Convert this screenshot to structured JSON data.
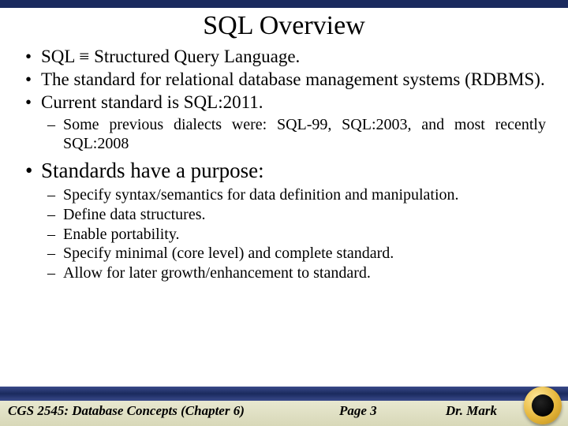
{
  "title": "SQL Overview",
  "bullets": {
    "b1": "SQL ≡ Structured Query Language.",
    "b2": "The standard for relational database management systems (RDBMS).",
    "b3": "Current standard is SQL:2011.",
    "b3_sub1": "Some previous dialects were: SQL-99, SQL:2003, and most recently SQL:2008",
    "b4": "Standards have a purpose:",
    "b4_sub1": "Specify syntax/semantics for data definition and manipulation.",
    "b4_sub2": "Define data structures.",
    "b4_sub3": "Enable portability.",
    "b4_sub4": "Specify minimal (core level) and complete standard.",
    "b4_sub5": "Allow for later growth/enhancement to standard."
  },
  "footer": {
    "left": "CGS 2545: Database Concepts  (Chapter 6)",
    "center": "Page 3",
    "right": "Dr. Mark"
  }
}
